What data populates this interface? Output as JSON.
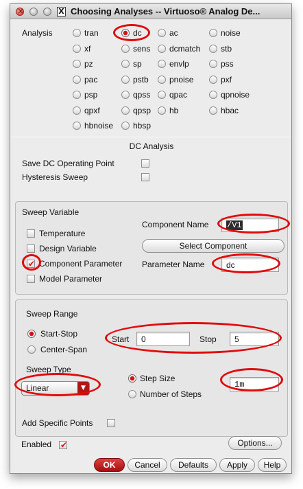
{
  "window": {
    "title": "Choosing Analyses -- Virtuoso® Analog De..."
  },
  "analysis": {
    "label": "Analysis",
    "options": [
      {
        "label": "tran",
        "selected": false
      },
      {
        "label": "dc",
        "selected": true
      },
      {
        "label": "ac",
        "selected": false
      },
      {
        "label": "noise",
        "selected": false
      },
      {
        "label": "xf",
        "selected": false
      },
      {
        "label": "sens",
        "selected": false
      },
      {
        "label": "dcmatch",
        "selected": false
      },
      {
        "label": "stb",
        "selected": false
      },
      {
        "label": "pz",
        "selected": false
      },
      {
        "label": "sp",
        "selected": false
      },
      {
        "label": "envlp",
        "selected": false
      },
      {
        "label": "pss",
        "selected": false
      },
      {
        "label": "pac",
        "selected": false
      },
      {
        "label": "pstb",
        "selected": false
      },
      {
        "label": "pnoise",
        "selected": false
      },
      {
        "label": "pxf",
        "selected": false
      },
      {
        "label": "psp",
        "selected": false
      },
      {
        "label": "qpss",
        "selected": false
      },
      {
        "label": "qpac",
        "selected": false
      },
      {
        "label": "qpnoise",
        "selected": false
      },
      {
        "label": "qpxf",
        "selected": false
      },
      {
        "label": "qpsp",
        "selected": false
      },
      {
        "label": "hb",
        "selected": false
      },
      {
        "label": "hbac",
        "selected": false
      },
      {
        "label": "hbnoise",
        "selected": false
      },
      {
        "label": "hbsp",
        "selected": false
      }
    ]
  },
  "dc": {
    "heading": "DC Analysis",
    "save_op_label": "Save DC Operating Point",
    "hysteresis_label": "Hysteresis Sweep"
  },
  "sweep_variable": {
    "title": "Sweep Variable",
    "options": [
      {
        "label": "Temperature",
        "checked": false
      },
      {
        "label": "Design Variable",
        "checked": false
      },
      {
        "label": "Component Parameter",
        "checked": true
      },
      {
        "label": "Model Parameter",
        "checked": false
      }
    ],
    "component_name_label": "Component Name",
    "component_name_value": "/V1",
    "select_component_label": "Select Component",
    "parameter_name_label": "Parameter Name",
    "parameter_name_value": "dc"
  },
  "sweep_range": {
    "title": "Sweep Range",
    "start_stop_label": "Start-Stop",
    "center_span_label": "Center-Span",
    "start_label": "Start",
    "start_value": "0",
    "stop_label": "Stop",
    "stop_value": "5"
  },
  "sweep_type": {
    "title": "Sweep Type",
    "value": "Linear",
    "step_size_label": "Step Size",
    "step_size_value": "1m",
    "num_steps_label": "Number of Steps",
    "add_points_label": "Add Specific Points"
  },
  "footer": {
    "enabled_label": "Enabled",
    "options_label": "Options...",
    "ok_label": "OK",
    "cancel_label": "Cancel",
    "defaults_label": "Defaults",
    "apply_label": "Apply",
    "help_label": "Help"
  },
  "colors": {
    "annotation": "#e10b0b",
    "accent": "#d01515"
  }
}
